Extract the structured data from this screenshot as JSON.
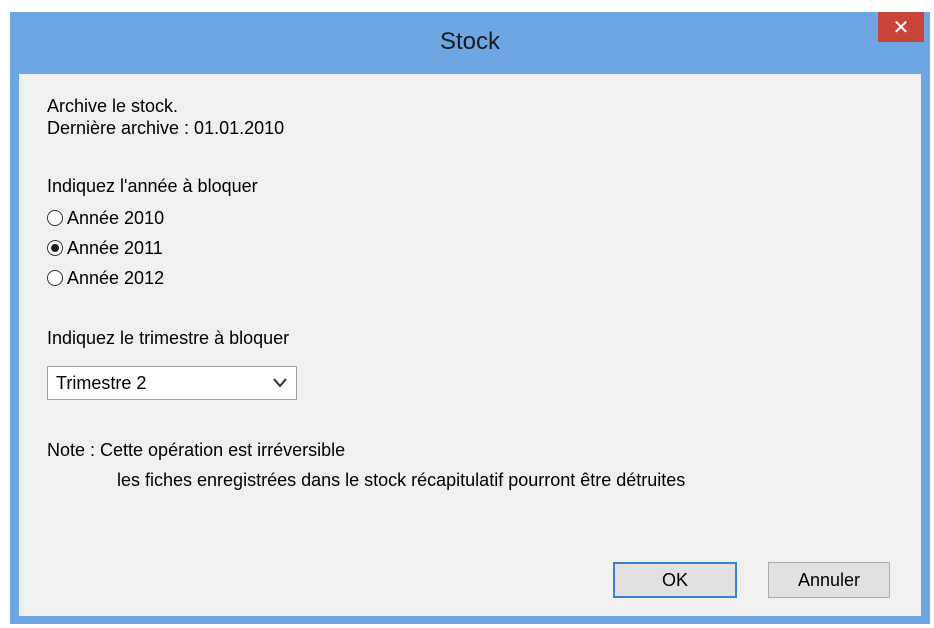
{
  "window": {
    "title": "Stock",
    "close_glyph": "✕"
  },
  "info": {
    "line1": "Archive le stock.",
    "line2": "Dernière archive : 01.01.2010"
  },
  "year_section": {
    "label": "Indiquez l'année à bloquer",
    "options": [
      {
        "label": "Année 2010",
        "checked": false
      },
      {
        "label": "Année 2011",
        "checked": true
      },
      {
        "label": "Année 2012",
        "checked": false
      }
    ]
  },
  "quarter_section": {
    "label": "Indiquez le trimestre à bloquer",
    "selected": "Trimestre 2"
  },
  "note": {
    "line1": "Note : Cette opération est irréversible",
    "line2": "les fiches enregistrées dans le stock récapitulatif pourront être détruites"
  },
  "buttons": {
    "ok": "OK",
    "cancel": "Annuler"
  },
  "colors": {
    "titlebar": "#6ea6e4",
    "close": "#c9453a",
    "client_bg": "#f0f0f0",
    "default_button_border": "#3c7fd9"
  },
  "icons": {
    "close": "close-icon",
    "dropdown": "chevron-down-icon"
  }
}
